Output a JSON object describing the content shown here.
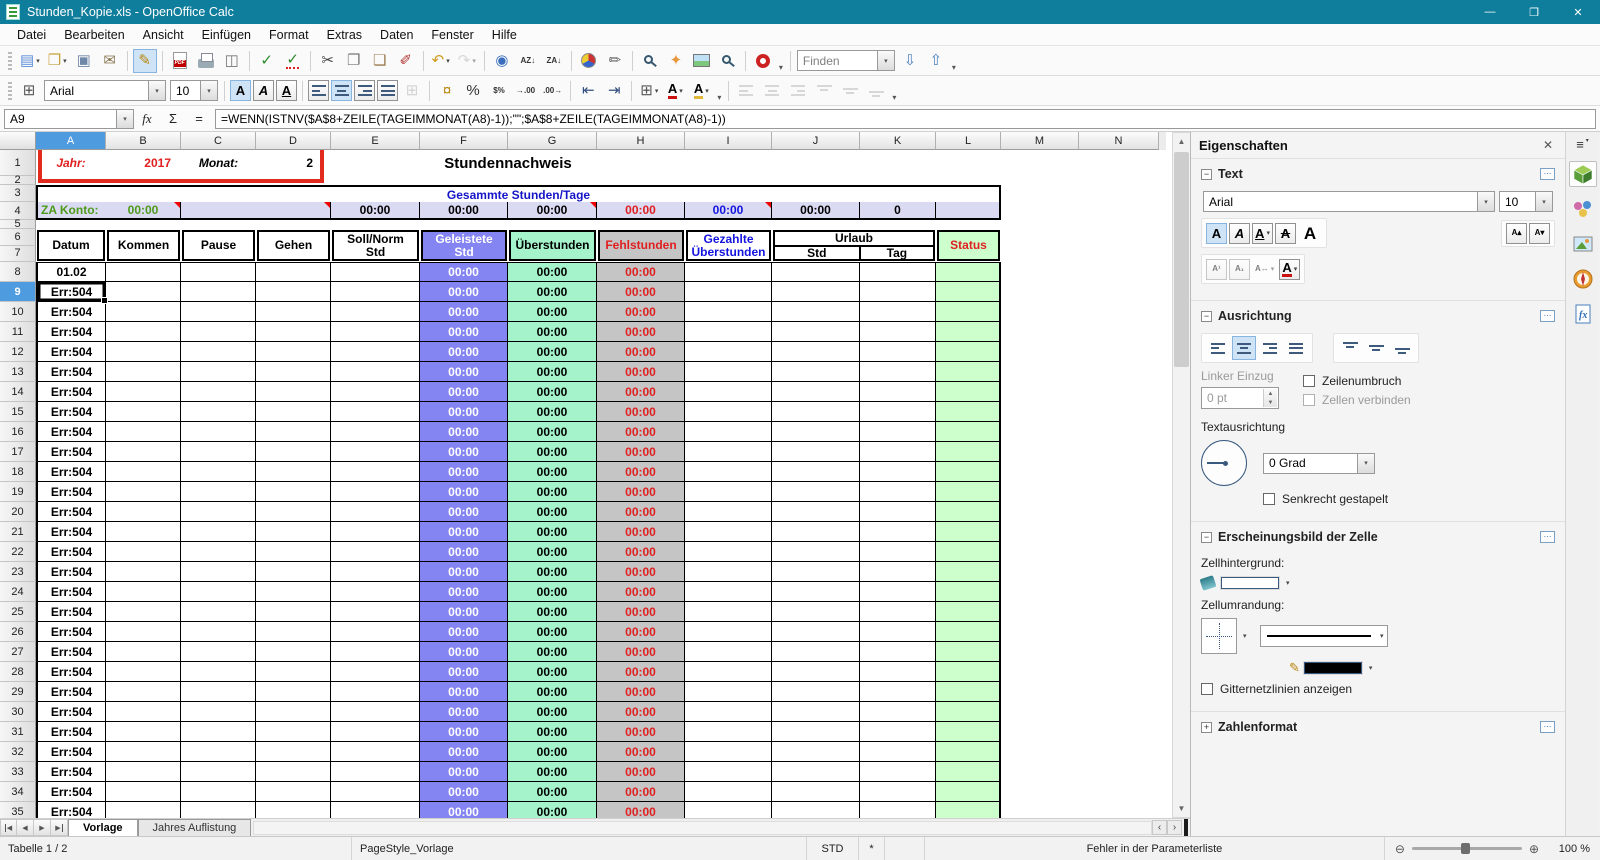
{
  "window": {
    "title": "Stunden_Kopie.xls - OpenOffice Calc",
    "minimize": "—",
    "restore": "❐",
    "close": "✕"
  },
  "menubar": [
    "Datei",
    "Bearbeiten",
    "Ansicht",
    "Einfügen",
    "Format",
    "Extras",
    "Daten",
    "Fenster",
    "Hilfe"
  ],
  "toolbars": {
    "font": "Arial",
    "size": "10",
    "standard": [
      {
        "n": "new-document",
        "g": "▤",
        "c": "#5b8dd9",
        "dd": 1
      },
      {
        "n": "open",
        "g": "❒",
        "c": "#c9a23f",
        "dd": 1
      },
      {
        "n": "save",
        "g": "▣",
        "c": "#6f87a8"
      },
      {
        "n": "email",
        "g": "✉",
        "c": "#8a7a55"
      },
      {
        "sep": 1
      },
      {
        "n": "edit-mode",
        "g": "✎",
        "c": "#b8860b",
        "active": 1
      },
      {
        "sep": 1
      },
      {
        "n": "export-pdf",
        "cls": "pdf"
      },
      {
        "n": "print",
        "cls": "printer"
      },
      {
        "n": "page-preview",
        "g": "◫",
        "c": "#777777"
      },
      {
        "sep": 1
      },
      {
        "n": "spellcheck",
        "g": "✓",
        "c": "#2e8b2e"
      },
      {
        "n": "auto-spellcheck",
        "g": "✓",
        "c": "#2e8b2e",
        "cls": "wavy"
      },
      {
        "sep": 1
      },
      {
        "n": "cut",
        "g": "✂",
        "c": "#444444"
      },
      {
        "n": "copy",
        "g": "❐",
        "c": "#777777"
      },
      {
        "n": "paste",
        "g": "❏",
        "c": "#9a7b4f"
      },
      {
        "n": "format-paintbrush",
        "g": "✐",
        "c": "#b03030"
      },
      {
        "sep": 1
      },
      {
        "n": "undo",
        "g": "↶",
        "c": "#d19a1e",
        "dd": 1
      },
      {
        "n": "redo",
        "g": "↷",
        "c": "#b5b5b5",
        "dd": 1,
        "dis": 1
      },
      {
        "sep": 1
      },
      {
        "n": "hyperlink",
        "g": "◉",
        "c": "#3a6ebd"
      },
      {
        "n": "sort-ascending",
        "g": "AZ↓",
        "small": 1,
        "c": "#333333"
      },
      {
        "n": "sort-descending",
        "g": "ZA↓",
        "small": 1,
        "c": "#333333"
      },
      {
        "sep": 1
      },
      {
        "n": "insert-chart",
        "cls": "pie"
      },
      {
        "n": "draw-functions",
        "g": "✏",
        "c": "#666666"
      },
      {
        "sep": 1
      },
      {
        "n": "find-replace",
        "cls": "mag"
      },
      {
        "n": "navigator",
        "g": "✦",
        "c": "#e8973d"
      },
      {
        "n": "gallery",
        "cls": "pic"
      },
      {
        "n": "zoom",
        "cls": "mag"
      },
      {
        "sep": 1
      },
      {
        "n": "help",
        "cls": "buoy"
      },
      {
        "of": 1
      },
      {
        "sep": 1
      },
      {
        "find": 1
      },
      {
        "n": "find-down",
        "g": "⇩",
        "c": "#4a7ebb"
      },
      {
        "n": "find-up",
        "g": "⇧",
        "c": "#4a7ebb"
      },
      {
        "of": 1
      }
    ],
    "find": {
      "value": "Finden"
    },
    "formatting": [
      {
        "n": "format-cells",
        "g": "⊞",
        "c": "#555555"
      },
      {
        "combo": "font",
        "w": 122
      },
      {
        "combo": "size",
        "w": 48
      },
      {
        "sep": 1
      },
      {
        "n": "bold",
        "g": "A",
        "cls": "b",
        "box": 1,
        "active": 1
      },
      {
        "n": "italic",
        "g": "A",
        "cls": "i",
        "box": 1
      },
      {
        "n": "underline",
        "g": "A",
        "cls": "u",
        "box": 1
      },
      {
        "sep": 1
      },
      {
        "n": "align-left",
        "cls": "al-l",
        "box": 1
      },
      {
        "n": "align-center",
        "cls": "al-c",
        "box": 1,
        "active": 1
      },
      {
        "n": "align-right",
        "cls": "al-r",
        "box": 1
      },
      {
        "n": "align-justify",
        "cls": "al-j",
        "box": 1
      },
      {
        "n": "merge-cells",
        "g": "⊞",
        "c": "#aaaaaa",
        "dis": 1
      },
      {
        "sep": 1
      },
      {
        "n": "number-currency",
        "g": "¤",
        "c": "#b8860b"
      },
      {
        "n": "number-percent",
        "g": "%",
        "c": "#333333"
      },
      {
        "n": "number-standard",
        "g": "$%",
        "small": 1,
        "c": "#333333"
      },
      {
        "n": "add-decimal",
        "g": "→.00",
        "small": 1,
        "c": "#333333"
      },
      {
        "n": "delete-decimal",
        "g": ".00→",
        "small": 1,
        "c": "#333333"
      },
      {
        "sep": 1
      },
      {
        "n": "decrease-indent",
        "g": "⇤",
        "c": "#334f7d"
      },
      {
        "n": "increase-indent",
        "g": "⇥",
        "c": "#334f7d"
      },
      {
        "sep": 1
      },
      {
        "n": "borders",
        "g": "⊞",
        "c": "#555555",
        "dd": 1
      },
      {
        "n": "font-color",
        "g": "A",
        "cls": "fc",
        "dd": 1
      },
      {
        "n": "background-color",
        "g": "A",
        "cls": "bc",
        "dd": 1
      },
      {
        "of": 1
      },
      {
        "sep": 1
      },
      {
        "n": "align-object-left",
        "cls": "al-l",
        "dis": 1
      },
      {
        "n": "center-horizontally",
        "cls": "al-c",
        "dis": 1
      },
      {
        "n": "align-object-right",
        "cls": "al-r",
        "dis": 1
      },
      {
        "n": "align-object-top",
        "cls": "va-t",
        "dis": 1
      },
      {
        "n": "center-vertically",
        "cls": "va-m",
        "dis": 1
      },
      {
        "n": "align-object-bottom",
        "cls": "va-b",
        "dis": 1
      },
      {
        "of": 1
      }
    ]
  },
  "formula": {
    "cell": "A9",
    "fx": "fx",
    "sum": "Σ",
    "eq": "=",
    "text": "=WENN(ISTNV($A$8+ZEILE(TAGEIMMONAT(A8)-1));\"\";$A$8+ZEILE(TAGEIMMONAT(A8)-1))"
  },
  "grid": {
    "row_labels": [
      "1",
      "2",
      "3",
      "4",
      "5",
      "6",
      "7"
    ],
    "columns": [
      [
        "A",
        70
      ],
      [
        "B",
        75
      ],
      [
        "C",
        75
      ],
      [
        "D",
        75
      ],
      [
        "E",
        89
      ],
      [
        "F",
        88
      ],
      [
        "G",
        89
      ],
      [
        "H",
        88
      ],
      [
        "I",
        87
      ],
      [
        "J",
        88
      ],
      [
        "K",
        76
      ],
      [
        "L",
        65
      ],
      [
        "M",
        78
      ],
      [
        "N",
        80
      ]
    ],
    "selected_column": "A",
    "selected_row": 9,
    "top": {
      "jahr_label": "Jahr:",
      "jahr": "2017",
      "monat_label": "Monat:",
      "monat": "2",
      "title": "Stundennachweis",
      "band": "Gesammte Stunden/Tage",
      "za": "ZA Konto:",
      "za_val": "00:00",
      "vals": [
        "00:00",
        "00:00",
        "00:00",
        "00:00",
        "00:00",
        "00:00",
        "0"
      ]
    },
    "head": {
      "datum": "Datum",
      "kommen": "Kommen",
      "pause": "Pause",
      "gehen": "Gehen",
      "soll": "Soll/Norm Std",
      "gel": "Geleistete Std",
      "ueber": "Überstunden",
      "fehl": "Fehlstunden",
      "gez": "Gezahlte Überstunden",
      "urlaub": "Urlaub",
      "std": "Std",
      "tag": "Tag",
      "status": "Status"
    },
    "data": {
      "first": "01.02",
      "err": "Err:504",
      "time": "00:00",
      "from": 8,
      "to": 35
    }
  },
  "tabs": {
    "nav": [
      "◀",
      "◀",
      "▶",
      "▶"
    ],
    "sheets": [
      {
        "label": "Vorlage",
        "active": true
      },
      {
        "label": "Jahres Auflistung",
        "active": false
      }
    ],
    "hleft": "‹",
    "hright": "›"
  },
  "status": {
    "left": "Tabelle 1 / 2",
    "pagestyle": "PageStyle_Vorlage",
    "mode": "STD",
    "modified": "*",
    "message": "Fehler in der Parameterliste",
    "zoom_minus": "⊖",
    "zoom_plus": "⊕",
    "zoom_pct": "100 %"
  },
  "sidebar": {
    "title": "Eigenschaften",
    "close": "✕",
    "menu": "≡",
    "collapse": "−",
    "expand": "+",
    "launcher": "⋯",
    "text": {
      "title": "Text",
      "font": "Arial",
      "size": "10"
    },
    "align": {
      "title": "Ausrichtung",
      "indent_label": "Linker Einzug",
      "indent_value": "0 pt",
      "wrap": "Zeilenumbruch",
      "merge": "Zellen verbinden",
      "orient": "Textausrichtung",
      "degrees": "0 Grad",
      "stacked": "Senkrecht gestapelt"
    },
    "cell": {
      "title": "Erscheinungsbild der Zelle",
      "bg": "Zellhintergrund:",
      "border": "Zellumrandung:",
      "grid": "Gitternetzlinien anzeigen"
    },
    "number": {
      "title": "Zahlenformat"
    },
    "icons": {
      "char": [
        {
          "n": "bold",
          "g": "A",
          "cls": "b",
          "box": 1,
          "active": 1
        },
        {
          "n": "italic",
          "g": "A",
          "cls": "i",
          "box": 1
        },
        {
          "n": "underline",
          "g": "A",
          "cls": "u",
          "box": 1,
          "dd": 1
        },
        {
          "n": "strikethrough",
          "g": "A",
          "cls": "s",
          "box": 1
        },
        {
          "n": "font-effects",
          "g": "A",
          "cls": "big"
        }
      ],
      "size": [
        {
          "n": "increase-font-size",
          "g": "A▴",
          "small": 1,
          "box": 1
        },
        {
          "n": "decrease-font-size",
          "g": "A▾",
          "small": 1,
          "box": 1
        }
      ],
      "char2": [
        {
          "n": "superscript",
          "g": "A¹",
          "small": 1,
          "box": 1,
          "dis": 1
        },
        {
          "n": "subscript",
          "g": "A₁",
          "small": 1,
          "box": 1,
          "dis": 1
        },
        {
          "n": "character-spacing",
          "g": "A↔",
          "small": 1,
          "dis": 1,
          "dd": 1
        },
        {
          "n": "font-color",
          "g": "A",
          "cls": "fc",
          "box": 1,
          "dd": 1
        }
      ],
      "halign": [
        {
          "n": "align-left",
          "cls": "al-l"
        },
        {
          "n": "align-center",
          "cls": "al-c",
          "active": 1
        },
        {
          "n": "align-right",
          "cls": "al-r"
        },
        {
          "n": "align-justify",
          "cls": "al-j"
        }
      ],
      "valign": [
        {
          "n": "align-top",
          "cls": "va-t"
        },
        {
          "n": "align-center-vertical",
          "cls": "va-m"
        },
        {
          "n": "align-bottom",
          "cls": "va-b"
        }
      ]
    }
  }
}
